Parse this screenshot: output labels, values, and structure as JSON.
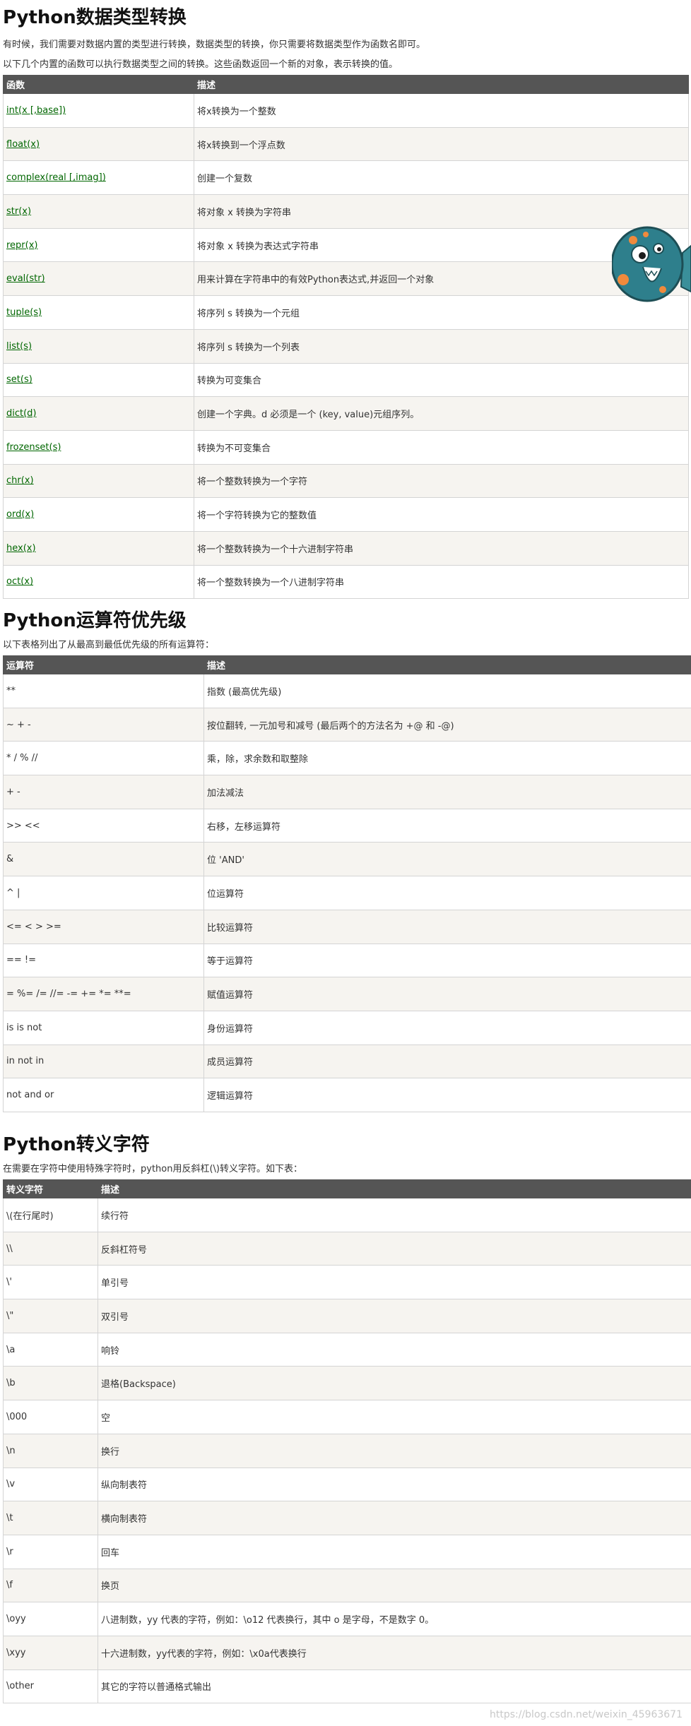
{
  "sections": [
    {
      "title": "Python数据类型转换",
      "paragraphs": [
        "有时候，我们需要对数据内置的类型进行转换，数据类型的转换，你只需要将数据类型作为函数名即可。",
        "以下几个内置的函数可以执行数据类型之间的转换。这些函数返回一个新的对象，表示转换的值。"
      ],
      "headers": [
        "函数",
        "描述"
      ],
      "rows": [
        [
          "int(x [,base])",
          "将x转换为一个整数"
        ],
        [
          "float(x)",
          "将x转换到一个浮点数"
        ],
        [
          "complex(real [,imag])",
          "创建一个复数"
        ],
        [
          "str(x)",
          "将对象 x 转换为字符串"
        ],
        [
          "repr(x)",
          "将对象 x 转换为表达式字符串"
        ],
        [
          "eval(str)",
          "用来计算在字符串中的有效Python表达式,并返回一个对象"
        ],
        [
          "tuple(s)",
          "将序列 s 转换为一个元组"
        ],
        [
          "list(s)",
          "将序列 s 转换为一个列表"
        ],
        [
          "set(s)",
          "转换为可变集合"
        ],
        [
          "dict(d)",
          "创建一个字典。d 必须是一个 (key, value)元组序列。"
        ],
        [
          "frozenset(s)",
          "转换为不可变集合"
        ],
        [
          "chr(x)",
          "将一个整数转换为一个字符"
        ],
        [
          "ord(x)",
          "将一个字符转换为它的整数值"
        ],
        [
          "hex(x)",
          "将一个整数转换为一个十六进制字符串"
        ],
        [
          "oct(x)",
          "将一个整数转换为一个八进制字符串"
        ]
      ]
    },
    {
      "title": "Python运算符优先级",
      "paragraphs": [
        "以下表格列出了从最高到最低优先级的所有运算符："
      ],
      "headers": [
        "运算符",
        "描述"
      ],
      "rows": [
        [
          "**",
          "指数 (最高优先级)"
        ],
        [
          "~ + -",
          "按位翻转, 一元加号和减号 (最后两个的方法名为 +@ 和 -@)"
        ],
        [
          "* / % //",
          "乘，除，求余数和取整除"
        ],
        [
          "+ -",
          "加法减法"
        ],
        [
          ">> <<",
          "右移，左移运算符"
        ],
        [
          "&",
          "位 'AND'"
        ],
        [
          "^ |",
          "位运算符"
        ],
        [
          "<= < > >=",
          "比较运算符"
        ],
        [
          "== !=",
          "等于运算符"
        ],
        [
          "= %= /= //= -= += *= **=",
          "赋值运算符"
        ],
        [
          "is is not",
          "身份运算符"
        ],
        [
          "in not in",
          "成员运算符"
        ],
        [
          "not and or",
          "逻辑运算符"
        ]
      ]
    },
    {
      "title": "Python转义字符",
      "paragraphs": [
        "在需要在字符中使用特殊字符时，python用反斜杠(\\)转义字符。如下表："
      ],
      "headers": [
        "转义字符",
        "描述"
      ],
      "rows": [
        [
          "\\(在行尾时)",
          "续行符"
        ],
        [
          "\\\\",
          "反斜杠符号"
        ],
        [
          "\\'",
          "单引号"
        ],
        [
          "\\\"",
          "双引号"
        ],
        [
          "\\a",
          "响铃"
        ],
        [
          "\\b",
          "退格(Backspace)"
        ],
        [
          "\\000",
          "空"
        ],
        [
          "\\n",
          "换行"
        ],
        [
          "\\v",
          "纵向制表符"
        ],
        [
          "\\t",
          "横向制表符"
        ],
        [
          "\\r",
          "回车"
        ],
        [
          "\\f",
          "换页"
        ],
        [
          "\\oyy",
          "八进制数，yy 代表的字符，例如：\\o12 代表换行，其中 o 是字母，不是数字 0。"
        ],
        [
          "\\xyy",
          "十六进制数，yy代表的字符，例如：\\x0a代表换行"
        ],
        [
          "\\other",
          "其它的字符以普通格式输出"
        ]
      ]
    }
  ],
  "watermark": "https://blog.csdn.net/weixin_45963671",
  "colors": {
    "header_bg": "#555555",
    "row_alt_bg": "#f6f4f0",
    "link": "#006600",
    "mascot_body": "#2e7f8c",
    "mascot_spots": "#f08a3c"
  },
  "icons": {
    "mascot": "monster-mascot-icon"
  }
}
